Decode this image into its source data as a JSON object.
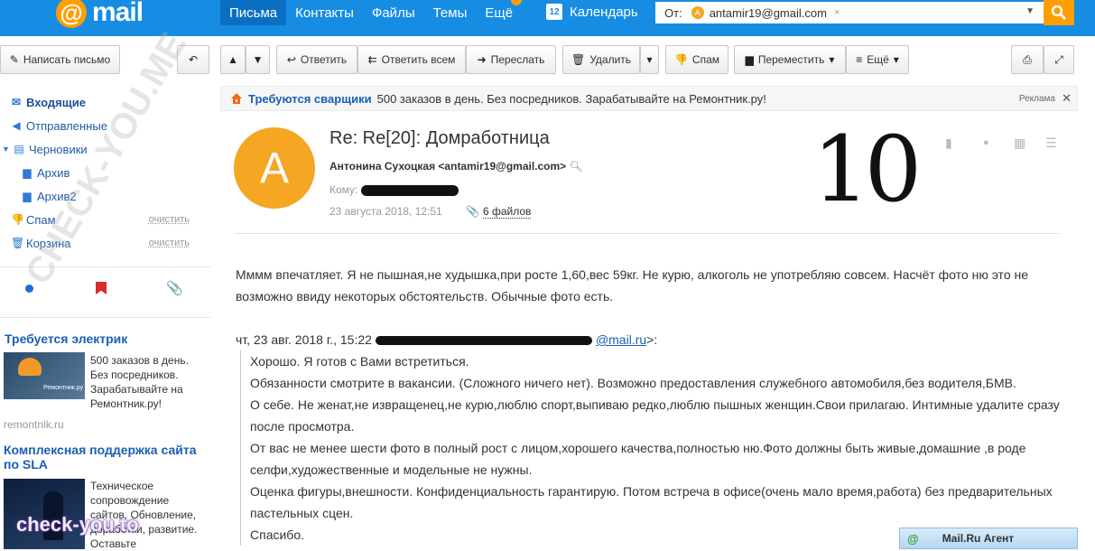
{
  "logo": {
    "word": "mail"
  },
  "nav": {
    "items": [
      "Письма",
      "Контакты",
      "Файлы",
      "Темы",
      "Ещё"
    ],
    "calendar_day": "12",
    "calendar": "Календарь"
  },
  "search": {
    "label": "От:",
    "avatar": "A",
    "email": "antamir19@gmail.com",
    "clear": "×"
  },
  "toolbar": {
    "compose": "Написать письмо",
    "reply": "Ответить",
    "reply_all": "Ответить всем",
    "forward": "Переслать",
    "delete": "Удалить",
    "spam": "Спам",
    "move": "Переместить",
    "more": "Ещё"
  },
  "sidebar": {
    "folders": [
      {
        "label": "Входящие",
        "icon": "inbox-icon"
      },
      {
        "label": "Отправленные",
        "icon": "sent-icon"
      },
      {
        "label": "Черновики",
        "icon": "drafts-icon"
      },
      {
        "label": "Архив",
        "icon": "folder-icon"
      },
      {
        "label": "Архив2",
        "icon": "folder-icon"
      },
      {
        "label": "Спам",
        "icon": "spam-icon",
        "clear": "очистить"
      },
      {
        "label": "Корзина",
        "icon": "trash-icon",
        "clear": "очистить"
      }
    ],
    "ads": [
      {
        "title": "Требуется электрик",
        "text": "500 заказов в день. Без посредников. Зарабатывайте на Ремонтник.ру!",
        "img_caption": "Ремонтник.ру",
        "source": "remontnik.ru"
      },
      {
        "title": "Комплексная поддержка сайта по SLA",
        "text": "Техническое сопровождение сайтов. Обновление, доработки, развитие. Оставьте"
      }
    ]
  },
  "banner": {
    "highlight": "Требуются сварщики",
    "text": "500 заказов в день. Без посредников. Зарабатывайте на Ремонтник.ру!",
    "ad_label": "Реклама"
  },
  "message": {
    "avatar": "А",
    "subject": "Re: Re[20]: Домработница",
    "from": "Антонина Сухоцкая <antamir19@gmail.com>",
    "to_label": "Кому:",
    "date": "23 августа 2018, 12:51",
    "files": "6 файлов",
    "handwritten": "10",
    "body": "Мммм впечатляет. Я не пышная,не худышка,при росте 1,60,вес 59кг. Не курю, алкоголь не употребляю совсем. Насчёт фото ню это не возможно ввиду некоторых обстоятельств. Обычные фото есть.",
    "quote_head_start": "чт, 23 авг. 2018 г., 15:22",
    "quote_head_mail": "@mail.ru",
    "quote_head_end": ">:",
    "quote_lines": [
      "Хорошо. Я готов с Вами встретиться.",
      "Обязанности смотрите в вакансии. (Сложного ничего нет). Возможно предоставления служебного автомобиля,без водителя,БМВ.",
      "О себе. Не женат,не извращенец,не курю,люблю спорт,выпиваю редко,люблю пышных женщин.Свои прилагаю. Интимные удалите сразу после просмотра.",
      "От вас не менее шести фото в полный рост с лицом,хорошего качества,полностью ню.Фото должны быть живые,домашние ,в роде селфи,художественные и модельные не нужны.",
      "Оценка фигуры,внешности. Конфиденциальность гарантирую. Потом встреча в офисе(очень мало время,работа) без предварительных пастельных сцен.",
      "Спасибо."
    ]
  },
  "agent": {
    "label": "Mail.Ru Агент",
    "icon": "@"
  },
  "watermark": {
    "diagonal": "CHECK-YOU.ME",
    "corner": "check-you.to"
  }
}
